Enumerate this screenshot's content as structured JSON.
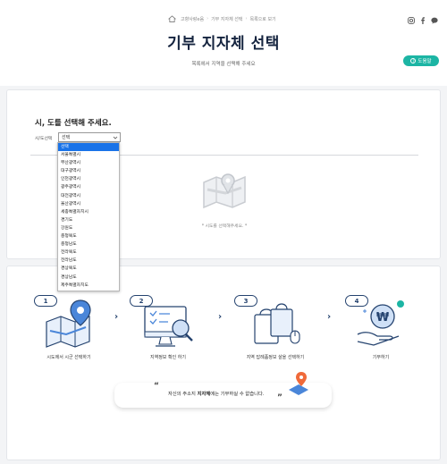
{
  "header": {
    "breadcrumb": [
      "고향사랑e음",
      "기부 지자체 선택",
      "목록으로 보기"
    ],
    "title": "기부 지자체 선택",
    "subtitle": "목록에서 지역을 선택해 주세요",
    "help_label": "도움말",
    "social_icons": [
      "instagram-icon",
      "facebook-icon",
      "chat-icon"
    ]
  },
  "selection": {
    "heading": "시, 도를 선택해 주세요.",
    "field_label": "시/도선택",
    "selected_value": "선택",
    "options": [
      "선택",
      "서울특별시",
      "부산광역시",
      "대구광역시",
      "인천광역시",
      "광주광역시",
      "대전광역시",
      "울산광역시",
      "세종특별자치시",
      "경기도",
      "강원도",
      "충청북도",
      "충청남도",
      "전라북도",
      "전라남도",
      "경상북도",
      "경상남도",
      "제주특별자치도"
    ],
    "empty_message": "* 시도를 선택해주세요. *"
  },
  "steps": [
    {
      "num": "1",
      "caption": "시도에서 시군 선택하기"
    },
    {
      "num": "2",
      "caption": "지역정보 확인 하기"
    },
    {
      "num": "3",
      "caption": "지역 답례품정보 살을 선택하기"
    },
    {
      "num": "4",
      "caption": "기부하기"
    }
  ],
  "notice": {
    "prefix": "자신의 주소지 ",
    "bold": "지자체",
    "suffix": "에는 기부하실 수 없습니다."
  },
  "colors": {
    "accent": "#1cb5a4",
    "navy": "#15243f",
    "select_highlight": "#1a73e8"
  }
}
